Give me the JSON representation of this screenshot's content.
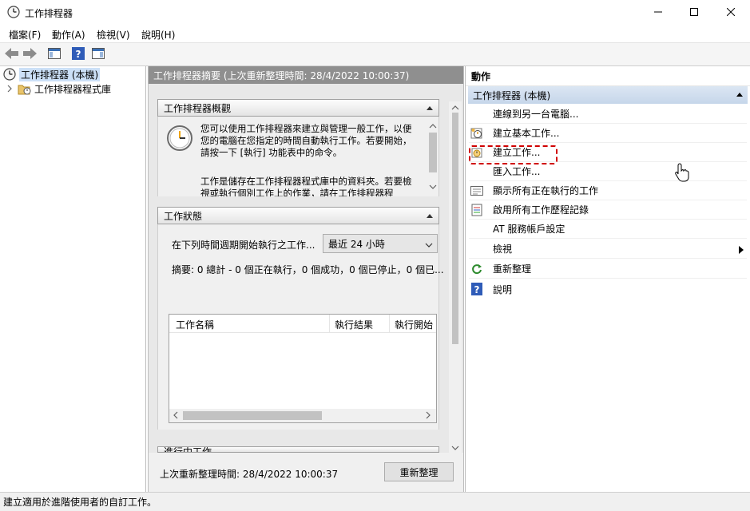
{
  "window": {
    "title": "工作排程器",
    "controls": {
      "minimize_icon": "minimize-icon",
      "maximize_icon": "maximize-icon",
      "close_icon": "close-icon"
    }
  },
  "menu": [
    "檔案(F)",
    "動作(A)",
    "檢視(V)",
    "說明(H)"
  ],
  "tree": {
    "root": "工作排程器 (本機)",
    "child": "工作排程器程式庫"
  },
  "center": {
    "header": "工作排程器摘要 (上次重新整理時間: 28/4/2022 10:00:37)",
    "overview": {
      "title": "工作排程器概觀",
      "para1": "您可以使用工作排程器來建立與管理一般工作，以便您的電腦在您指定的時間自動執行工作。若要開始，請按一下 [執行] 功能表中的命令。",
      "para2": "工作是儲存在工作排程器程式庫中的資料夾。若要檢視或執行個別工作上的作業，請在工作排程器程"
    },
    "status": {
      "title": "工作狀態",
      "period_label": "在下列時間週期開始執行之工作...",
      "period_value": "最近 24 小時",
      "summary": "摘要: 0 總計 - 0 個正在執行，0 個成功，0 個已停止，0 個已...",
      "columns": [
        "工作名稱",
        "執行結果",
        "執行開始"
      ]
    },
    "running_title": "進行中工作",
    "footer": {
      "last_refresh": "上次重新整理時間: 28/4/2022 10:00:37",
      "refresh_button": "重新整理"
    }
  },
  "actions": {
    "title": "動作",
    "group": "工作排程器 (本機)",
    "items": [
      {
        "label": "連線到另一台電腦...",
        "icon": ""
      },
      {
        "label": "建立基本工作...",
        "icon": "basic-task-icon"
      },
      {
        "label": "建立工作...",
        "icon": "create-task-icon"
      },
      {
        "label": "匯入工作...",
        "icon": ""
      },
      {
        "label": "顯示所有正在執行的工作",
        "icon": "running-tasks-icon"
      },
      {
        "label": "啟用所有工作歷程記錄",
        "icon": "history-icon"
      },
      {
        "label": "AT 服務帳戶設定",
        "icon": ""
      },
      {
        "label": "檢視",
        "icon": ""
      },
      {
        "label": "重新整理",
        "icon": "refresh-icon"
      },
      {
        "label": "說明",
        "icon": "help-icon"
      }
    ]
  },
  "status_bar": "建立適用於進階使用者的自訂工作。",
  "colors": {
    "highlight": "#d00000",
    "group_bg": "#c6d6ea",
    "center_header": "#8f8f8f"
  }
}
